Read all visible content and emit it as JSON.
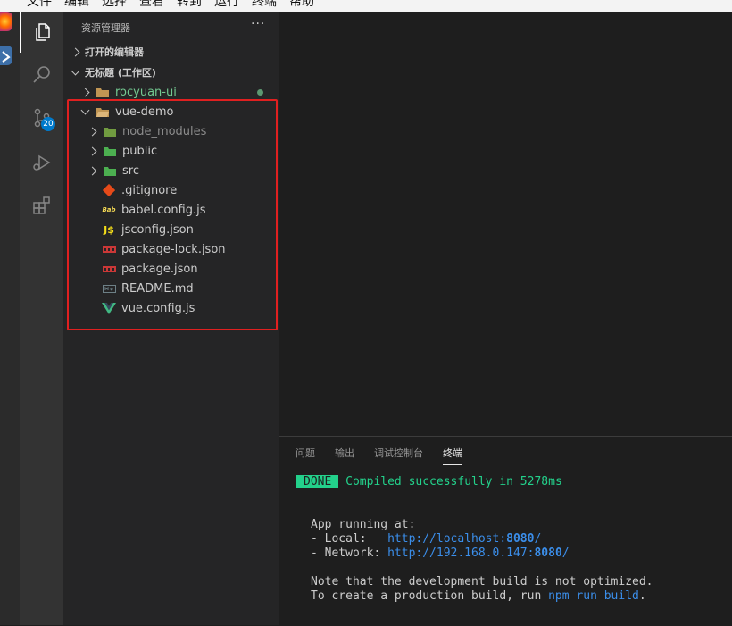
{
  "menubar": {
    "items": [
      "文件",
      "编辑",
      "选择",
      "查看",
      "转到",
      "运行",
      "终端",
      "帮助"
    ]
  },
  "activity_bar": {
    "items": [
      {
        "icon": "files-icon",
        "active": true
      },
      {
        "icon": "search-icon"
      },
      {
        "icon": "source-control-icon",
        "badge": "20"
      },
      {
        "icon": "run-debug-icon"
      },
      {
        "icon": "extensions-icon"
      }
    ]
  },
  "sidebar": {
    "title": "资源管理器",
    "more": "···",
    "open_editors": "打开的编辑器",
    "workspace": "无标题 (工作区)",
    "tree": [
      {
        "name": "rocyuan-ui",
        "type": "folder",
        "color": "#73c991"
      },
      {
        "name": "vue-demo",
        "type": "folder-open"
      },
      {
        "name": "node_modules",
        "type": "folder",
        "color": "#8c8c8c"
      },
      {
        "name": "public",
        "type": "folder"
      },
      {
        "name": "src",
        "type": "folder"
      },
      {
        "name": ".gitignore",
        "type": "file",
        "icon": "git-icon"
      },
      {
        "name": "babel.config.js",
        "type": "file",
        "icon": "babel-icon"
      },
      {
        "name": "jsconfig.json",
        "type": "file",
        "icon": "json-icon",
        "glyph": "J$"
      },
      {
        "name": "package-lock.json",
        "type": "file",
        "icon": "npm-icon"
      },
      {
        "name": "package.json",
        "type": "file",
        "icon": "npm-icon"
      },
      {
        "name": "README.md",
        "type": "file",
        "icon": "markdown-icon"
      },
      {
        "name": "vue.config.js",
        "type": "file",
        "icon": "vue-icon"
      }
    ]
  },
  "panel": {
    "tabs": [
      "问题",
      "输出",
      "调试控制台",
      "终端"
    ],
    "active_tab": "终端",
    "terminal": {
      "done_badge": "DONE",
      "compiled": "Compiled successfully in 5278ms",
      "app_running": "App running at:",
      "local_label": "- Local:   ",
      "local_url": "http://localhost:",
      "local_port": "8080",
      "local_slash": "/",
      "network_label": "- Network: ",
      "network_url": "http://192.168.0.147:",
      "network_port": "8080",
      "network_slash": "/",
      "note_line": "Note that the development build is not optimized.",
      "create_prefix": "To create a production build, run ",
      "create_cmd": "npm run build",
      "create_suffix": "."
    }
  },
  "colors": {
    "accent": "#007acc",
    "highlight_box": "#e02020",
    "terminal_green": "#23d18b",
    "terminal_blue": "#3b8eea"
  }
}
